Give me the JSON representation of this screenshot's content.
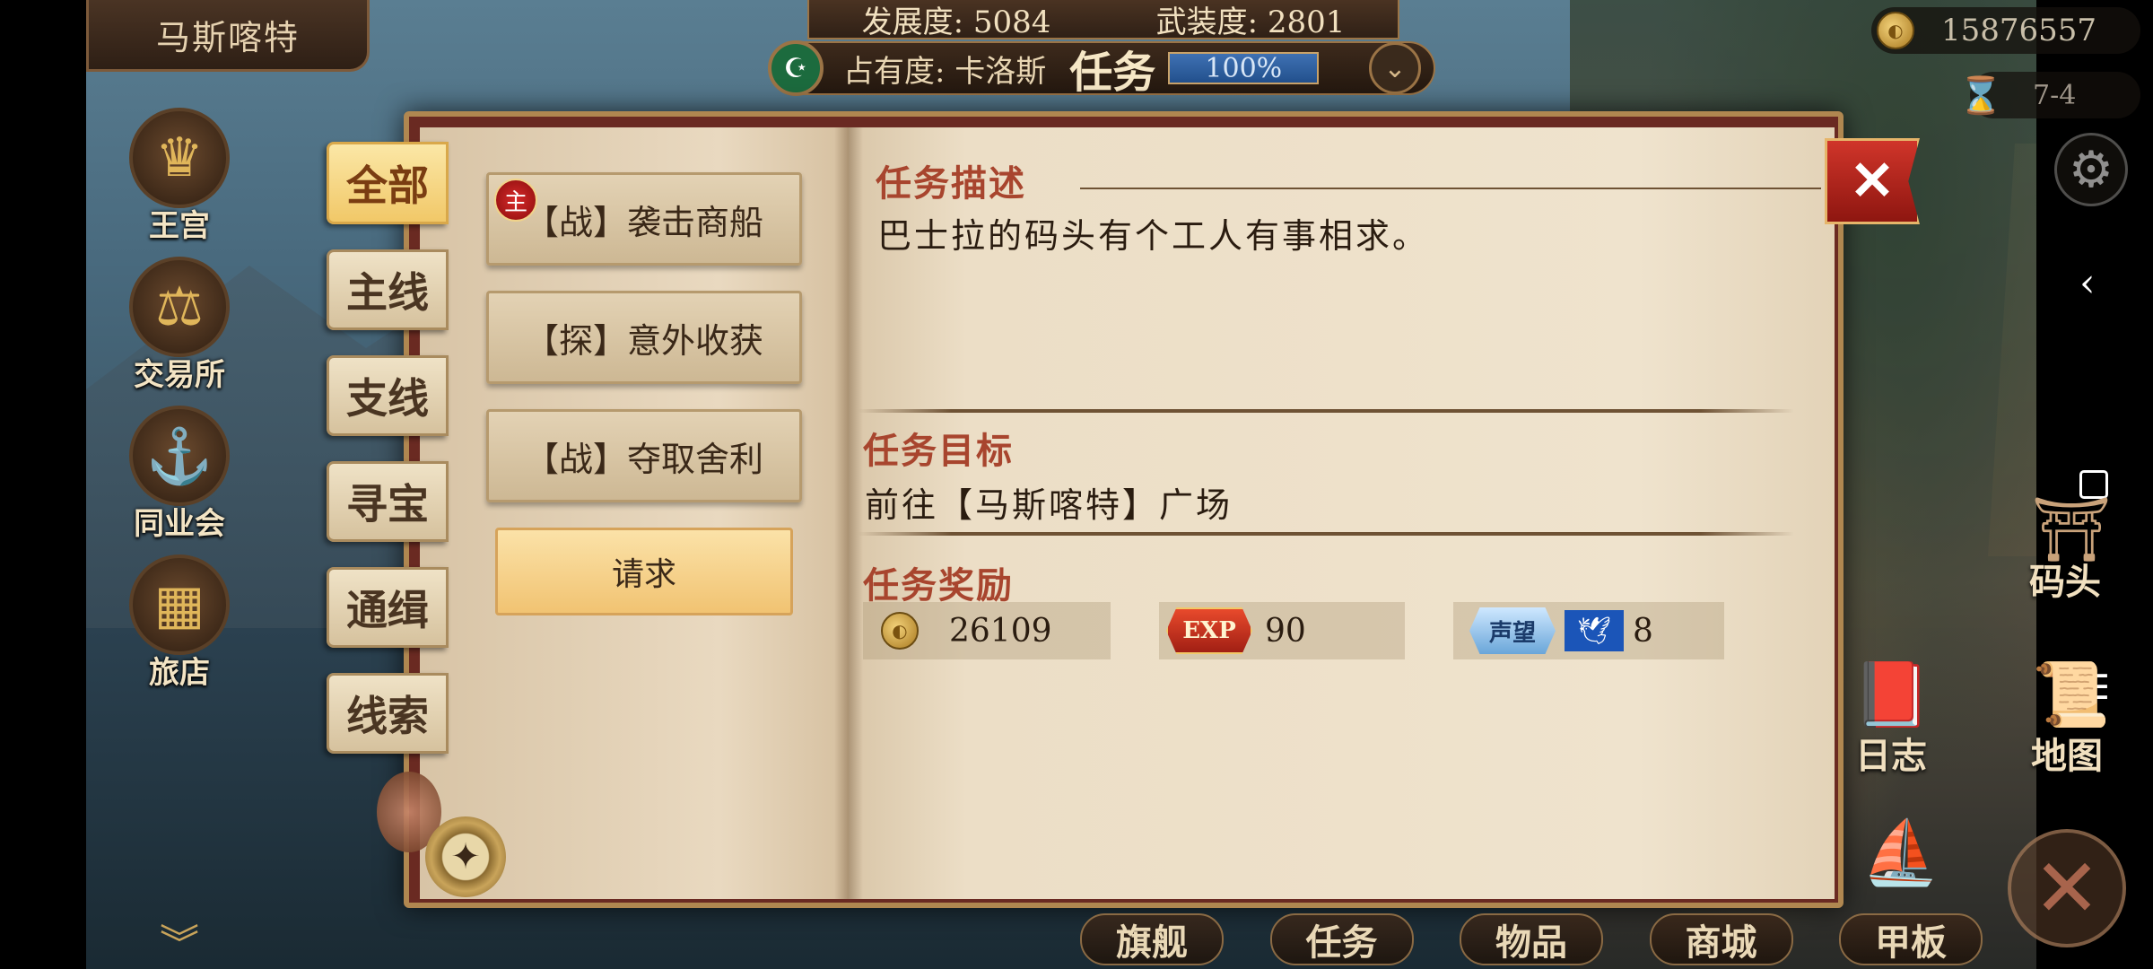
{
  "city": "马斯喀特",
  "top": {
    "development_label": "发展度:",
    "development_value": "5084",
    "armament_label": "武装度:",
    "armament_value": "2801",
    "occupancy_label": "占有度: 卡洛斯",
    "screen_title": "任务",
    "occupancy_percent_text": "100%",
    "occupancy_fraction": 1.0
  },
  "currency": {
    "gold": "15876557",
    "date": "7-4"
  },
  "left_menu": [
    {
      "label": "王宫",
      "icon": "crown-icon",
      "glyph": "♛"
    },
    {
      "label": "交易所",
      "icon": "scales-icon",
      "glyph": "⚖"
    },
    {
      "label": "同业会",
      "icon": "anchor-icon",
      "glyph": "⚓"
    },
    {
      "label": "旅店",
      "icon": "basket-icon",
      "glyph": "▦"
    }
  ],
  "tabs": [
    {
      "label": "全部",
      "active": true
    },
    {
      "label": "主线"
    },
    {
      "label": "支线"
    },
    {
      "label": "寻宝"
    },
    {
      "label": "通缉"
    },
    {
      "label": "线索"
    }
  ],
  "quests": [
    {
      "label": "【战】袭击商船",
      "badge": "主"
    },
    {
      "label": "【探】意外收获"
    },
    {
      "label": "【战】夺取舍利"
    }
  ],
  "request_button": "请求",
  "detail": {
    "description_title": "任务描述",
    "description_text": "巴士拉的码头有个工人有事相求。",
    "goal_title": "任务目标",
    "goal_text": "前往【马斯喀特】广场",
    "reward_title": "任务奖励",
    "rewards": {
      "gold": "26109",
      "exp_badge": "EXP",
      "exp": "90",
      "reputation_badge": "声望",
      "reputation": "8"
    }
  },
  "close_glyph": "✕",
  "side": {
    "dock": "码头",
    "log": "日志",
    "map": "地图"
  },
  "bottom_nav": [
    "旗舰",
    "任务",
    "物品",
    "商城",
    "甲板"
  ]
}
